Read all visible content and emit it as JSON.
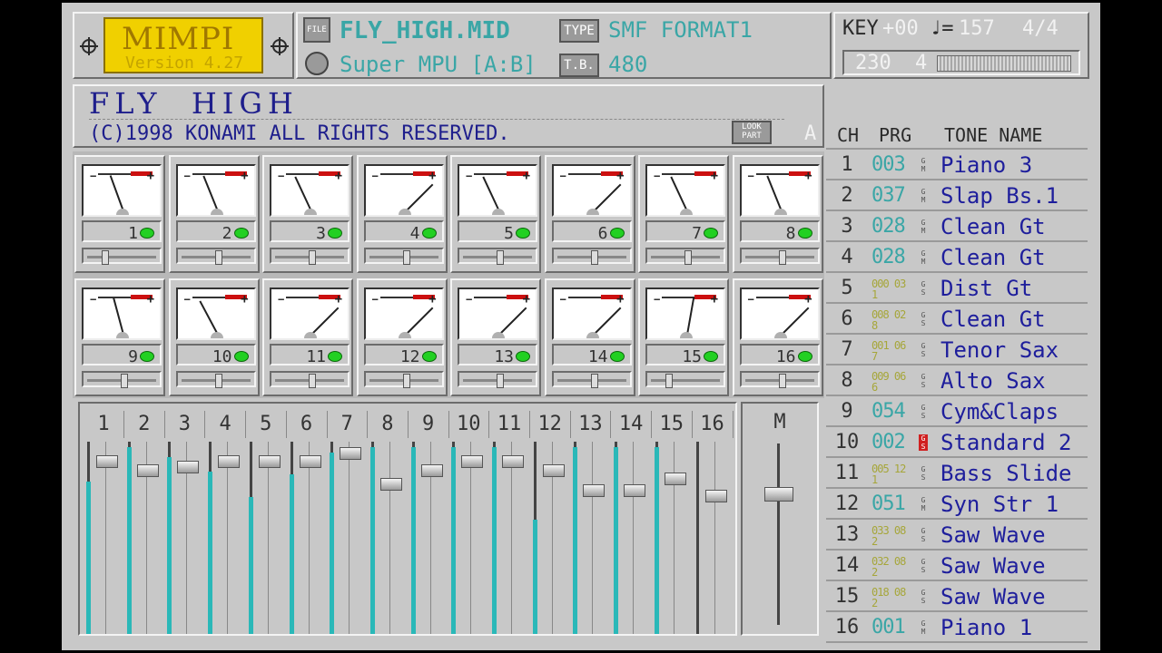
{
  "app": {
    "logo": "MIMPI",
    "version": "Version 4.27"
  },
  "file": {
    "icon_label": "FILE",
    "name": "FLY_HIGH.MID",
    "type_label": "TYPE",
    "type": "SMF FORMAT1",
    "device": "Super MPU [A:B]",
    "tb_label": "T.B.",
    "timebase": "480"
  },
  "status": {
    "key_label": "KEY",
    "key": "+00",
    "tempo_label": "♩=",
    "tempo": "157",
    "time_sig": "4/4",
    "counter": "230",
    "beat": "4"
  },
  "song": {
    "title": "FLY  HIGH",
    "copyright": "(C)1998 KONAMI ALL RIGHTS RESERVED.",
    "look_part_label": "LOOK PART",
    "part": "A"
  },
  "meters": [
    {
      "ch": "1",
      "angle": 20
    },
    {
      "ch": "2",
      "angle": 22
    },
    {
      "ch": "3",
      "angle": 25
    },
    {
      "ch": "4",
      "angle": -45
    },
    {
      "ch": "5",
      "angle": 25
    },
    {
      "ch": "6",
      "angle": -45
    },
    {
      "ch": "7",
      "angle": 25
    },
    {
      "ch": "8",
      "angle": 22
    },
    {
      "ch": "9",
      "angle": 15
    },
    {
      "ch": "10",
      "angle": 28
    },
    {
      "ch": "11",
      "angle": -45
    },
    {
      "ch": "12",
      "angle": -45
    },
    {
      "ch": "13",
      "angle": -45
    },
    {
      "ch": "14",
      "angle": -45
    },
    {
      "ch": "15",
      "angle": -10
    },
    {
      "ch": "16",
      "angle": -45
    }
  ],
  "pans": [
    0.22,
    0.5,
    0.5,
    0.5,
    0.5,
    0.5,
    0.5,
    0.5,
    0.5,
    0.5,
    0.5,
    0.5,
    0.5,
    0.5,
    0.22,
    0.5
  ],
  "faders": [
    {
      "label": "1",
      "level": 0.8,
      "thumb": 0.07
    },
    {
      "label": "2",
      "level": 0.98,
      "thumb": 0.12
    },
    {
      "label": "3",
      "level": 0.93,
      "thumb": 0.1
    },
    {
      "label": "4",
      "level": 0.85,
      "thumb": 0.07
    },
    {
      "label": "5",
      "level": 0.72,
      "thumb": 0.07
    },
    {
      "label": "6",
      "level": 0.84,
      "thumb": 0.07
    },
    {
      "label": "7",
      "level": 0.95,
      "thumb": 0.03
    },
    {
      "label": "8",
      "level": 0.98,
      "thumb": 0.19
    },
    {
      "label": "9",
      "level": 0.98,
      "thumb": 0.12
    },
    {
      "label": "10",
      "level": 0.98,
      "thumb": 0.07
    },
    {
      "label": "11",
      "level": 0.98,
      "thumb": 0.07
    },
    {
      "label": "12",
      "level": 0.6,
      "thumb": 0.12
    },
    {
      "label": "13",
      "level": 0.98,
      "thumb": 0.22
    },
    {
      "label": "14",
      "level": 0.98,
      "thumb": 0.22
    },
    {
      "label": "15",
      "level": 0.98,
      "thumb": 0.16
    },
    {
      "label": "16",
      "level": 0.0,
      "thumb": 0.25
    }
  ],
  "master": {
    "label": "M",
    "thumb": 0.24
  },
  "tone_list": {
    "header": {
      "ch": "CH",
      "prg": "PRG",
      "name": "TONE NAME"
    },
    "rows": [
      {
        "ch": "1",
        "prg": "003",
        "map": "G M",
        "name": "Piano 3"
      },
      {
        "ch": "2",
        "prg": "037",
        "map": "G M",
        "name": "Slap Bs.1"
      },
      {
        "ch": "3",
        "prg": "028",
        "map": "G M",
        "name": "Clean Gt"
      },
      {
        "ch": "4",
        "prg": "028",
        "map": "G M",
        "name": "Clean Gt"
      },
      {
        "ch": "5",
        "prg": "000 031",
        "map": "G S",
        "name": "Dist Gt"
      },
      {
        "ch": "6",
        "prg": "008 028",
        "map": "G S",
        "name": "Clean Gt"
      },
      {
        "ch": "7",
        "prg": "001 067",
        "map": "G S",
        "name": "Tenor Sax"
      },
      {
        "ch": "8",
        "prg": "009 066",
        "map": "G S",
        "name": "Alto Sax"
      },
      {
        "ch": "9",
        "prg": "054",
        "map": "G S",
        "name": "Cym&Claps"
      },
      {
        "ch": "10",
        "prg": "002",
        "map": "G S",
        "name": "Standard 2"
      },
      {
        "ch": "11",
        "prg": "005 121",
        "map": "G S",
        "name": "Bass Slide"
      },
      {
        "ch": "12",
        "prg": "051",
        "map": "G M",
        "name": "Syn Str 1"
      },
      {
        "ch": "13",
        "prg": "033 082",
        "map": "G S",
        "name": "Saw Wave"
      },
      {
        "ch": "14",
        "prg": "032 082",
        "map": "G S",
        "name": "Saw Wave"
      },
      {
        "ch": "15",
        "prg": "018 082",
        "map": "G S",
        "name": "Saw Wave"
      },
      {
        "ch": "16",
        "prg": "001",
        "map": "G M",
        "name": "Piano 1"
      }
    ]
  }
}
